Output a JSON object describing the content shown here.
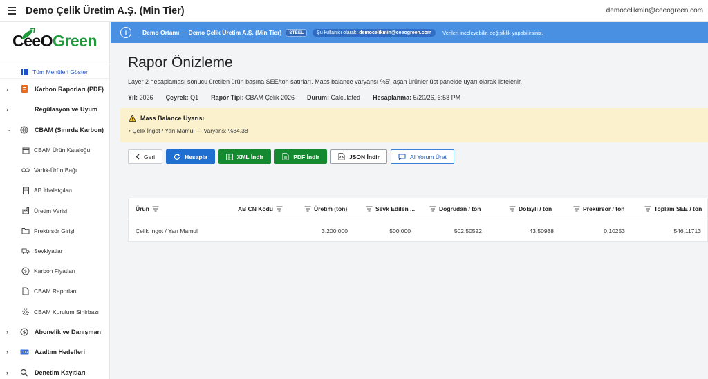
{
  "app": {
    "title": "Demo Çelik Üretim A.Ş. (Min Tier)",
    "user_email": "democelikmin@ceeogreen.com"
  },
  "logo": {
    "part1": "CeeO",
    "part2": "Green"
  },
  "sidebar": {
    "show_all": "Tüm Menüleri Göster",
    "items": [
      {
        "type": "group",
        "label": "Karbon Raporları (PDF)",
        "icon": "document-badge-icon",
        "chev": "›"
      },
      {
        "type": "group",
        "label": "Regülasyon ve Uyum",
        "icon": "",
        "chev": "›"
      },
      {
        "type": "group",
        "label": "CBAM (Sınırda Karbon)",
        "icon": "globe-icon",
        "chev": "⌄"
      },
      {
        "type": "sub",
        "label": "CBAM Ürün Kataloğu",
        "icon": "box-icon"
      },
      {
        "type": "sub",
        "label": "Varlık-Ürün Bağı",
        "icon": "link-icon"
      },
      {
        "type": "sub",
        "label": "AB İthalatçıları",
        "icon": "building-icon"
      },
      {
        "type": "sub",
        "label": "Üretim Verisi",
        "icon": "factory-icon"
      },
      {
        "type": "sub",
        "label": "Prekürsör Girişi",
        "icon": "folder-icon"
      },
      {
        "type": "sub",
        "label": "Sevkiyatlar",
        "icon": "truck-icon"
      },
      {
        "type": "sub",
        "label": "Karbon Fiyatları",
        "icon": "coin-icon"
      },
      {
        "type": "sub",
        "label": "CBAM Raporları",
        "icon": "file-icon"
      },
      {
        "type": "sub",
        "label": "CBAM Kurulum Sihirbazı",
        "icon": "gear-icon"
      },
      {
        "type": "group",
        "label": "Abonelik ve Danışman",
        "icon": "coin-icon",
        "chev": "›"
      },
      {
        "type": "group",
        "label": "Azaltım Hedefleri",
        "icon": "target-badge-icon",
        "chev": "›"
      },
      {
        "type": "group",
        "label": "Denetim Kayıtları",
        "icon": "search-icon",
        "chev": "›"
      }
    ]
  },
  "banner": {
    "title": "Demo Ortamı — Demo Çelik Üretim A.Ş. (Min Tier)",
    "badge": "STEEL",
    "user_prefix": "Şu kullanıcı olarak:",
    "user_email": "democelikmin@ceeogreen.com",
    "note": "Verileri inceleyebilir, değişiklik yapabilirsiniz."
  },
  "page": {
    "title": "Rapor Önizleme",
    "description": "Layer 2 hesaplaması sonucu üretilen ürün başına SEE/ton satırları. Mass balance varyansı %5'i aşan ürünler üst panelde uyarı olarak listelenir.",
    "meta": [
      {
        "label": "Yıl:",
        "value": "2026"
      },
      {
        "label": "Çeyrek:",
        "value": "Q1"
      },
      {
        "label": "Rapor Tipi:",
        "value": "CBAM Çelik 2026"
      },
      {
        "label": "Durum:",
        "value": "Calculated"
      },
      {
        "label": "Hesaplanma:",
        "value": "5/20/26, 6:58 PM"
      }
    ]
  },
  "warning": {
    "title": "Mass Balance Uyarısı",
    "items": [
      "Çelik İngot / Yarı Mamul — Varyans: %84.38"
    ]
  },
  "actions": {
    "back": "Geri",
    "calculate": "Hesapla",
    "xml": "XML İndir",
    "pdf": "PDF İndir",
    "json": "JSON İndir",
    "ai": "AI Yorum Üret"
  },
  "table": {
    "columns": [
      "Ürün",
      "AB CN Kodu",
      "Üretim (ton)",
      "Sevk Edilen ...",
      "Doğrudan / ton",
      "Dolaylı / ton",
      "Prekürsör / ton",
      "Toplam SEE / ton"
    ],
    "rows": [
      [
        "Çelik İngot / Yarı Mamul",
        "",
        "3.200,000",
        "500,000",
        "502,50522",
        "43,50938",
        "0,10253",
        "546,11713"
      ]
    ]
  },
  "colors": {
    "banner": "#4a90e2",
    "primary_blue": "#1f6fd0",
    "green": "#14892f",
    "warning_bg": "#fbf1cc"
  }
}
